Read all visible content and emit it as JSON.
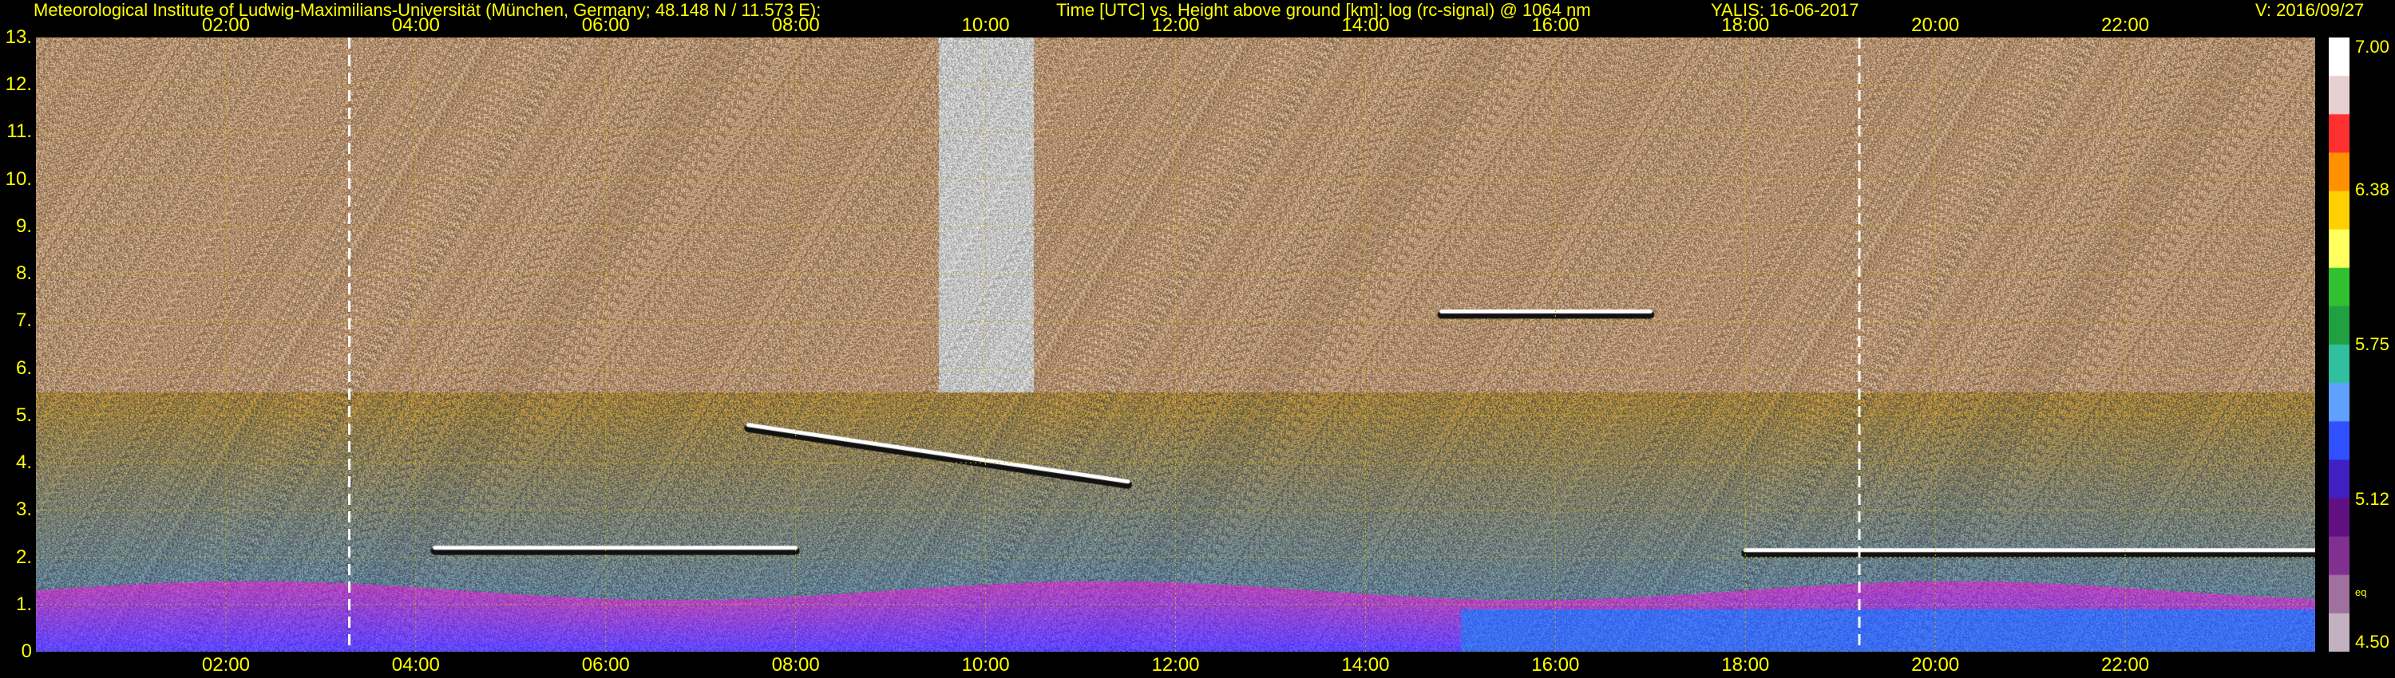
{
  "header": {
    "institute": "Meteorological Institute of Ludwig-Maximilians-Universität (München, Germany; 48.148 N / 11.573 E):",
    "description": "Time [UTC] vs. Height above ground [km]: log (rc-signal) @ 1064 nm",
    "instrument_date": "YALIS: 16-06-2017",
    "version": "V: 2016/09/27"
  },
  "chart_data": {
    "type": "heatmap",
    "title": "Time [UTC] vs. Height above ground [km]: log (rc-signal) @ 1064 nm",
    "xlabel": "Time [UTC]",
    "ylabel": "Height above ground [km]",
    "x_ticks": [
      "02:00",
      "04:00",
      "06:00",
      "08:00",
      "10:00",
      "12:00",
      "14:00",
      "16:00",
      "18:00",
      "20:00",
      "22:00"
    ],
    "x_tick_hours": [
      2,
      4,
      6,
      8,
      10,
      12,
      14,
      16,
      18,
      20,
      22
    ],
    "xlim_hours": [
      0,
      24
    ],
    "y_ticks": [
      "0",
      "1.",
      "2.",
      "3.",
      "4.",
      "5.",
      "6.",
      "7.",
      "8.",
      "9.",
      "10.",
      "11.",
      "12.",
      "13."
    ],
    "y_tick_values": [
      0,
      1,
      2,
      3,
      4,
      5,
      6,
      7,
      8,
      9,
      10,
      11,
      12,
      13
    ],
    "ylim_km": [
      0,
      13
    ],
    "grid": true,
    "colorbar": {
      "labels": [
        "7.00",
        "6.38",
        "5.75",
        "5.12",
        "4.50"
      ],
      "values": [
        7.0,
        6.38,
        5.75,
        5.12,
        4.5
      ],
      "tag": "eq",
      "range": [
        4.5,
        7.0
      ]
    },
    "markers_hours": [
      3.3,
      19.2
    ],
    "features": [
      {
        "name": "boundary-layer",
        "time_start": 0,
        "time_end": 24,
        "top_km": 1.3
      },
      {
        "name": "cloud-layer-evening",
        "time_start": 18.0,
        "time_end": 24,
        "height_km": 2.15
      },
      {
        "name": "cloud-layer-midday",
        "time_start": 4.2,
        "time_end": 8.0,
        "height_km": 2.2
      },
      {
        "name": "cloud-layer-descending",
        "time_start": 7.5,
        "time_end": 11.5,
        "height_km_start": 4.8,
        "height_km_end": 3.6
      },
      {
        "name": "cloud-layer-afternoon",
        "time_start": 14.8,
        "time_end": 17.0,
        "height_km": 7.2
      }
    ]
  },
  "colors": {
    "text": "#ffff00",
    "background": "#000000",
    "grid": "#c8b400",
    "marker_line": "#ffffff"
  }
}
